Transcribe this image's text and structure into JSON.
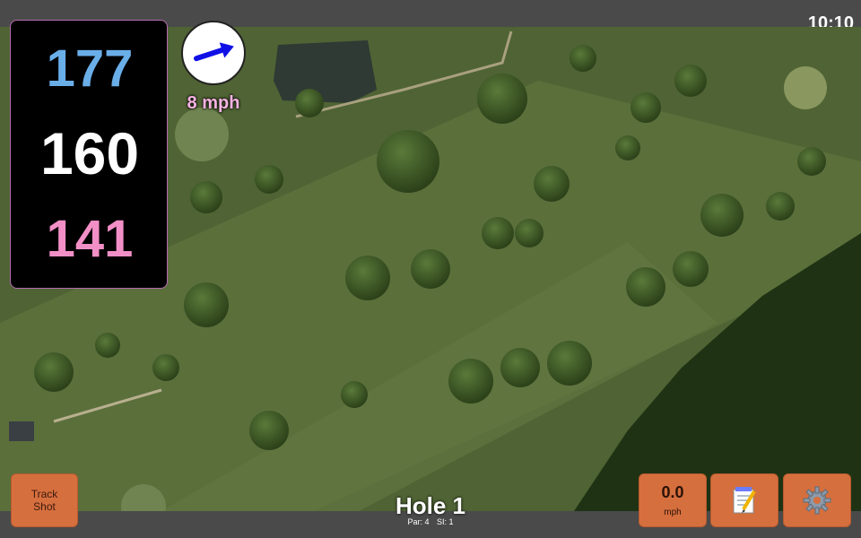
{
  "status": {
    "time": "10:10"
  },
  "distances": {
    "back": "177",
    "middle": "160",
    "front": "141"
  },
  "wind": {
    "speed": "8 mph",
    "direction_deg": 72,
    "arrow_color": "#1010e6"
  },
  "hole": {
    "title": "Hole 1",
    "par": "Par: 4",
    "si": "SI: 1"
  },
  "buttons": {
    "track_shot_line1": "Track",
    "track_shot_line2": "Shot",
    "speed_value": "0.0",
    "speed_unit": "mph",
    "notes_icon": "notepad-icon",
    "settings_icon": "gear-icon"
  },
  "colors": {
    "button_bg": "#d66f3e",
    "back_distance": "#6aaee8",
    "middle_distance": "#ffffff",
    "front_distance": "#f28fc7",
    "wind_text": "#f7b3e2"
  }
}
